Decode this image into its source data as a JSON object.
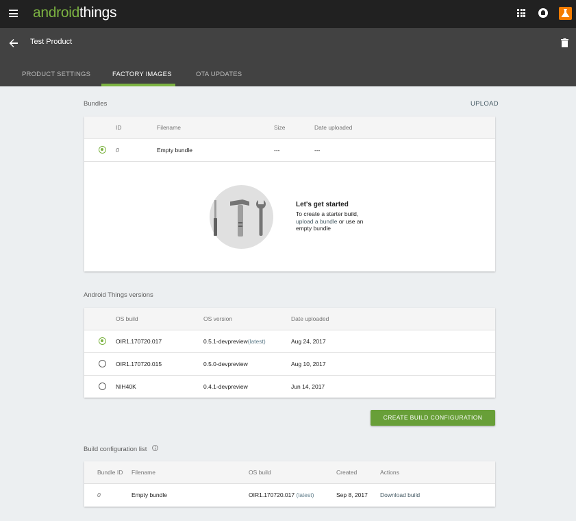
{
  "app": {
    "logo_part1": "android",
    "logo_part2": "things",
    "icons": [
      "menu-icon",
      "apps-icon",
      "notifications-icon",
      "avatar-icon"
    ]
  },
  "product": {
    "title": "Test Product",
    "tabs": [
      {
        "label": "PRODUCT SETTINGS",
        "active": false
      },
      {
        "label": "FACTORY IMAGES",
        "active": true
      },
      {
        "label": "OTA UPDATES",
        "active": false
      }
    ]
  },
  "bundles": {
    "title": "Bundles",
    "upload_label": "UPLOAD",
    "columns": [
      "ID",
      "Filename",
      "Size",
      "Date uploaded"
    ],
    "rows": [
      {
        "id": "0",
        "filename": "Empty bundle",
        "size": "---",
        "date": "---",
        "selected": true
      }
    ],
    "empty_state": {
      "title": "Let's get started",
      "line1": "To create a starter build,",
      "link": "upload a bundle",
      "line2_rest": " or use an",
      "line3": "empty bundle"
    }
  },
  "versions": {
    "title": "Android Things versions",
    "columns": [
      "OS build",
      "OS version",
      "Date uploaded"
    ],
    "rows": [
      {
        "build": "OIR1.170720.017",
        "version": "0.5.1-devpreview",
        "tag": "(latest)",
        "date": "Aug 24, 2017",
        "selected": true
      },
      {
        "build": "OIR1.170720.015",
        "version": "0.5.0-devpreview",
        "tag": "",
        "date": "Aug 10, 2017",
        "selected": false
      },
      {
        "build": "NIH40K",
        "version": "0.4.1-devpreview",
        "tag": "",
        "date": "Jun 14, 2017",
        "selected": false
      }
    ]
  },
  "create_button_label": "CREATE BUILD CONFIGURATION",
  "configs": {
    "title": "Build configuration list",
    "columns": [
      "Bundle ID",
      "Filename",
      "OS build",
      "Created",
      "Actions"
    ],
    "rows": [
      {
        "bundle_id": "0",
        "filename": "Empty bundle",
        "os_build": "OIR1.170720.017",
        "tag": "(latest)",
        "created": "Sep 8, 2017",
        "action": "Download build"
      }
    ]
  },
  "colors": {
    "accent": "#7cb342",
    "button": "#689f38",
    "topbar": "#212121",
    "productbar": "#424242"
  }
}
